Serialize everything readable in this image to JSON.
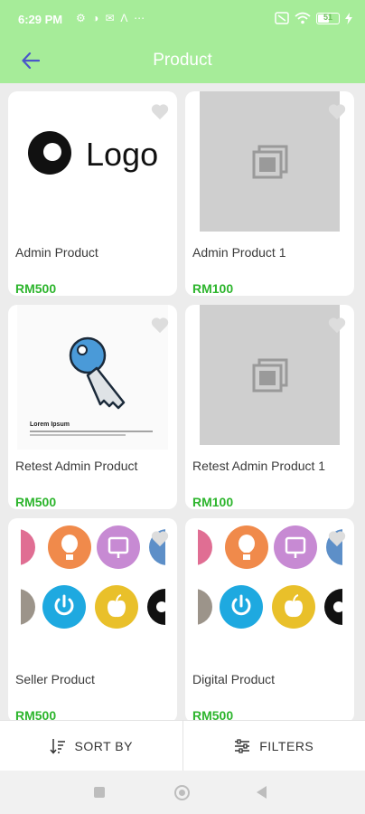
{
  "status_bar": {
    "time": "6:29 PM",
    "notification_icons": "⚙ ◑ ✉ Λ ⋯",
    "battery_level": "51"
  },
  "app_bar": {
    "title": "Product"
  },
  "products": [
    {
      "name": "Admin Product",
      "price": "RM500",
      "image": "logo",
      "logo_text": "Logo"
    },
    {
      "name": "Admin Product 1",
      "price": "RM100",
      "image": "placeholder"
    },
    {
      "name": "Retest Admin Product",
      "price": "RM500",
      "image": "key",
      "caption": "Lorem Ipsum"
    },
    {
      "name": "Retest Admin Product 1",
      "price": "RM100",
      "image": "placeholder"
    },
    {
      "name": "Seller Product",
      "price": "RM500",
      "image": "icons"
    },
    {
      "name": "Digital Product",
      "price": "RM500",
      "image": "icons"
    }
  ],
  "bottom_bar": {
    "sort_label": "SORT BY",
    "filter_label": "FILTERS"
  },
  "colors": {
    "header_green": "#a6ec99",
    "price_green": "#2db52d",
    "back_arrow": "#4a56c9"
  }
}
